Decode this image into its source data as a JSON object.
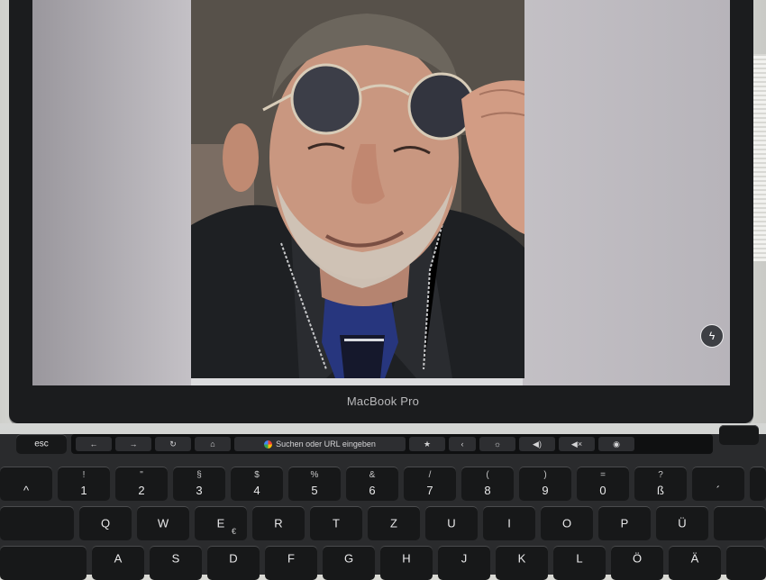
{
  "bezel_label": "MacBook Pro",
  "touchbar": {
    "esc": "esc",
    "back": "←",
    "forward": "→",
    "reload": "↻",
    "home": "⌂",
    "url_text": "Suchen oder URL eingeben",
    "star": "★",
    "bright_down": "‹",
    "brightness": "☼",
    "volume": "◀)",
    "mute": "◀×",
    "siri": "◉"
  },
  "keys_row1": [
    {
      "top": "",
      "bottom": "^"
    },
    {
      "top": "!",
      "bottom": "1"
    },
    {
      "top": "\"",
      "bottom": "2"
    },
    {
      "top": "§",
      "bottom": "3"
    },
    {
      "top": "$",
      "bottom": "4"
    },
    {
      "top": "%",
      "bottom": "5"
    },
    {
      "top": "&",
      "bottom": "6"
    },
    {
      "top": "/",
      "bottom": "7"
    },
    {
      "top": "(",
      "bottom": "8"
    },
    {
      "top": ")",
      "bottom": "9"
    },
    {
      "top": "=",
      "bottom": "0"
    },
    {
      "top": "?",
      "bottom": "ß"
    },
    {
      "top": "",
      "bottom": "´"
    }
  ],
  "keys_row2": [
    "Q",
    "W",
    "E",
    "R",
    "T",
    "Z",
    "U",
    "I",
    "O",
    "P",
    "Ü"
  ],
  "keys_row2_sub": {
    "E": "€"
  },
  "keys_row3": [
    "A",
    "S",
    "D",
    "F",
    "G",
    "H",
    "J",
    "K",
    "L",
    "Ö",
    "Ä"
  ],
  "icons": {
    "messenger": "messenger-icon"
  }
}
